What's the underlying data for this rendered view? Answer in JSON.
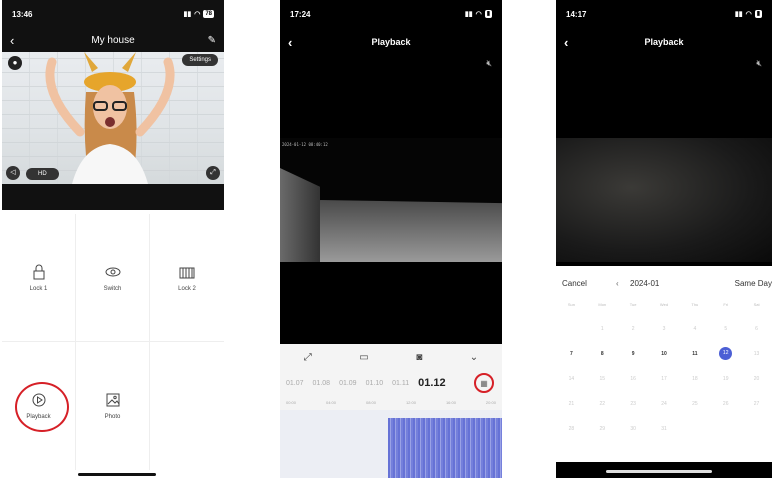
{
  "phone1": {
    "status_time": "13:46",
    "battery": "78",
    "title": "My house",
    "settings_label": "Settings",
    "hd_label": "HD",
    "grid": [
      {
        "label": "Lock 1",
        "icon": "lock-icon"
      },
      {
        "label": "Switch",
        "icon": "eye-icon"
      },
      {
        "label": "Lock 2",
        "icon": "gate-icon"
      },
      {
        "label": "Playback",
        "icon": "play-circle-icon"
      },
      {
        "label": "Photo",
        "icon": "image-icon"
      }
    ]
  },
  "phone2": {
    "status_time": "17:24",
    "title": "Playback",
    "timestamp": "2024-01-12 08:40:12",
    "dates": [
      "01.07",
      "01.08",
      "01.09",
      "01.10",
      "01.11"
    ],
    "selected_date": "01.12",
    "timeline_labels": [
      "00:00",
      "04:00",
      "08:00",
      "12:00",
      "16:00",
      "20:00"
    ]
  },
  "phone3": {
    "status_time": "14:17",
    "title": "Playback",
    "cancel_label": "Cancel",
    "month": "2024-01",
    "same_day_label": "Same Day",
    "weekdays": [
      "Sun",
      "Mon",
      "Tue",
      "Wed",
      "Thu",
      "Fri",
      "Sat"
    ],
    "days": [
      "",
      "1",
      "2",
      "3",
      "4",
      "5",
      "6",
      "7",
      "8",
      "9",
      "10",
      "11",
      "12",
      "13",
      "14",
      "15",
      "16",
      "17",
      "18",
      "19",
      "20",
      "21",
      "22",
      "23",
      "24",
      "25",
      "26",
      "27",
      "28",
      "29",
      "30",
      "31"
    ],
    "active_days": [
      "7",
      "8",
      "9",
      "10",
      "11"
    ],
    "today": "12"
  }
}
